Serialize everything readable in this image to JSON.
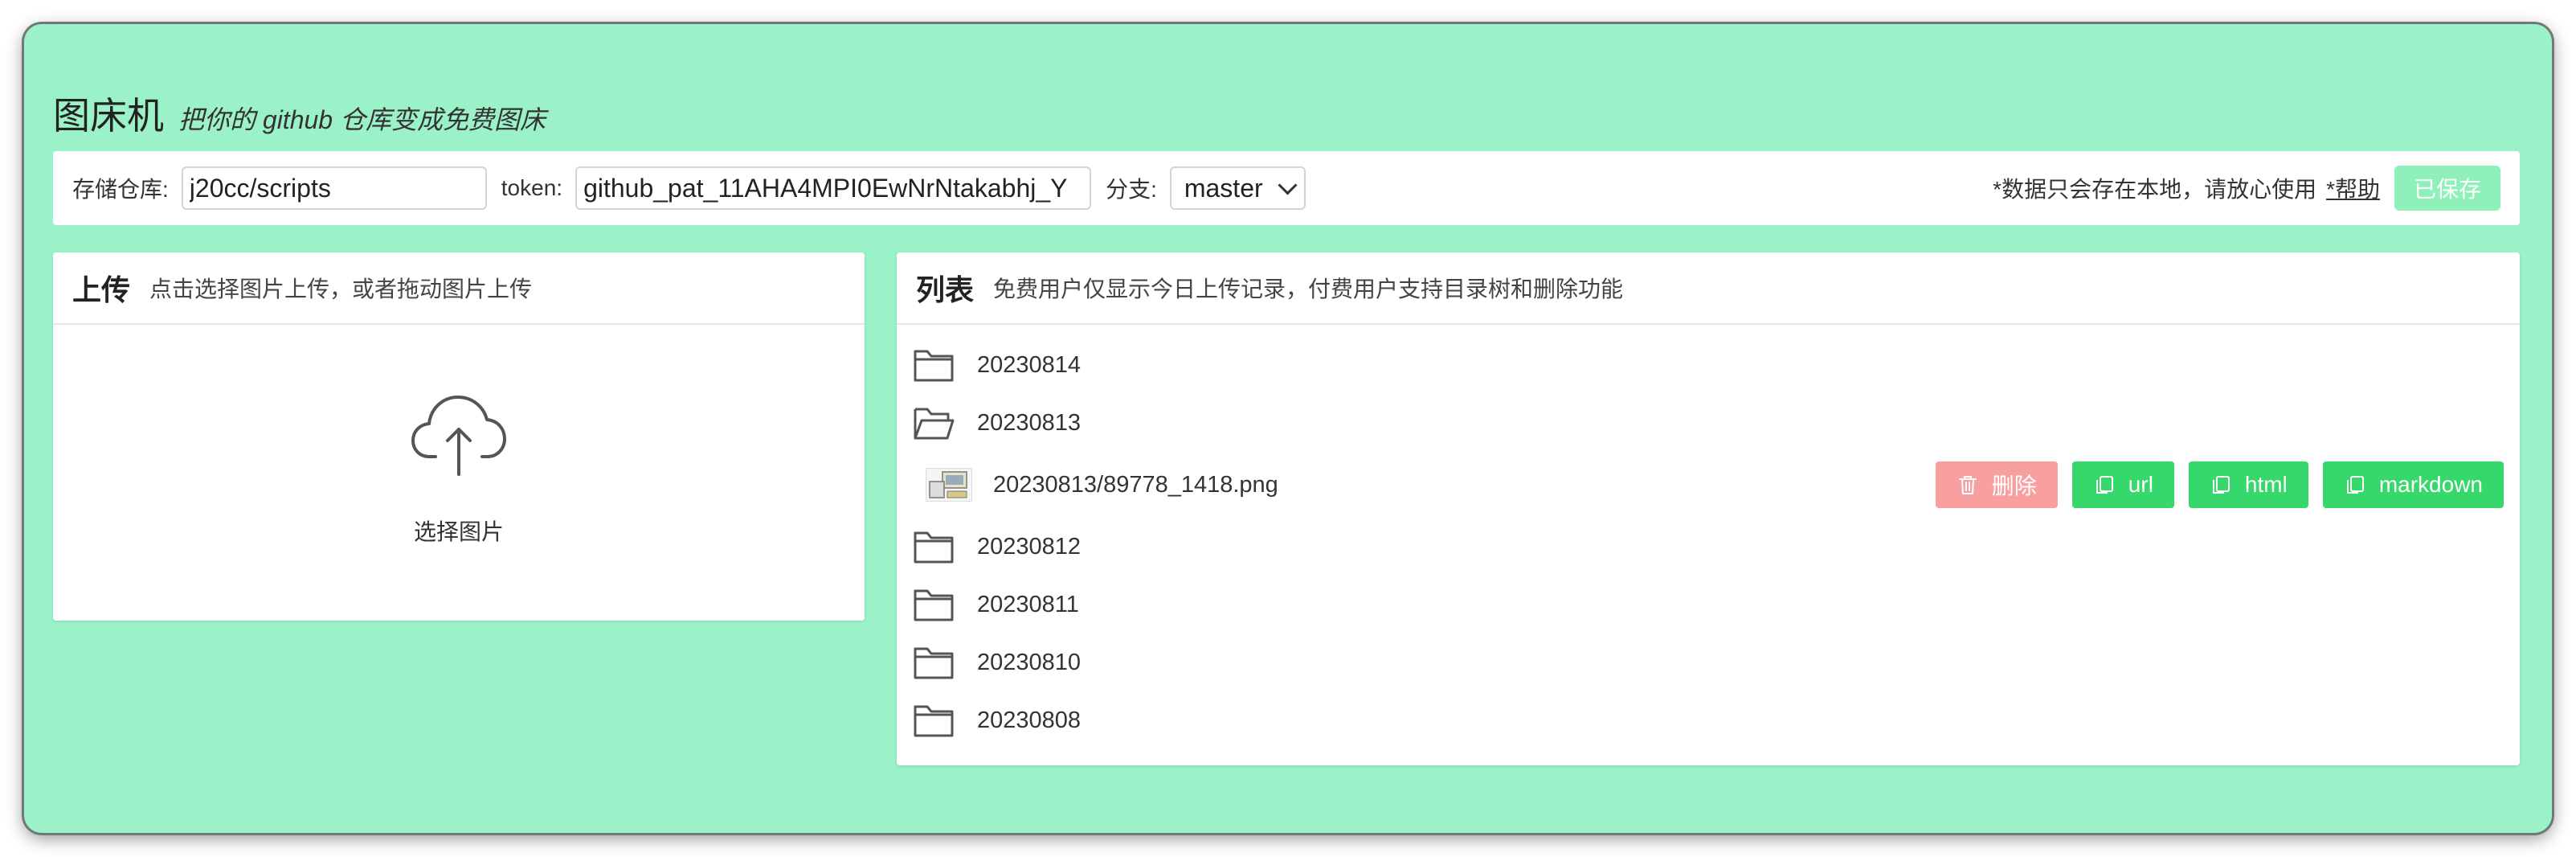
{
  "app": {
    "title": "图床机",
    "subtitle": "把你的 github 仓库变成免费图床"
  },
  "config": {
    "repo_label": "存储仓库:",
    "repo_value": "j20cc/scripts",
    "token_label": "token:",
    "token_value": "github_pat_11AHA4MPI0EwNrNtakabhj_Y",
    "branch_label": "分支:",
    "branch_value": "master",
    "notice": "*数据只会存在本地，请放心使用",
    "help_link": "*帮助",
    "saved_button": "已保存"
  },
  "upload": {
    "title": "上传",
    "description": "点击选择图片上传，或者拖动图片上传",
    "icon": "cloud-upload-icon",
    "select_label": "选择图片"
  },
  "list": {
    "title": "列表",
    "description": "免费用户仅显示今日上传记录，付费用户支持目录树和删除功能",
    "folders": [
      {
        "name": "20230814",
        "open": false
      },
      {
        "name": "20230813",
        "open": true
      },
      {
        "name": "20230812",
        "open": false
      },
      {
        "name": "20230811",
        "open": false
      },
      {
        "name": "20230810",
        "open": false
      },
      {
        "name": "20230808",
        "open": false
      }
    ],
    "file": {
      "name": "20230813/89778_1418.png",
      "delete_label": "删除",
      "url_label": "url",
      "html_label": "html",
      "markdown_label": "markdown"
    }
  },
  "colors": {
    "background": "#9bf2c8",
    "saved_button": "#8ff0b9",
    "copy_button": "#36d86b",
    "delete_button": "#f8a0a0"
  }
}
